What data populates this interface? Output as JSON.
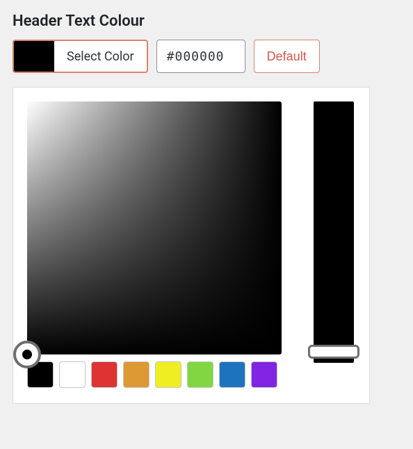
{
  "title": "Header Text Colour",
  "selectColor": {
    "label": "Select Color",
    "swatchColor": "#000000"
  },
  "hexValue": "#000000",
  "defaultLabel": "Default",
  "hueStripColor": "#000000",
  "svHandleColor": "#000000",
  "swatches": [
    {
      "color": "#000000"
    },
    {
      "color": "#ffffff"
    },
    {
      "color": "#dd3333"
    },
    {
      "color": "#dd9933"
    },
    {
      "color": "#eeee22"
    },
    {
      "color": "#81d742"
    },
    {
      "color": "#1e73be"
    },
    {
      "color": "#8224e3"
    }
  ]
}
